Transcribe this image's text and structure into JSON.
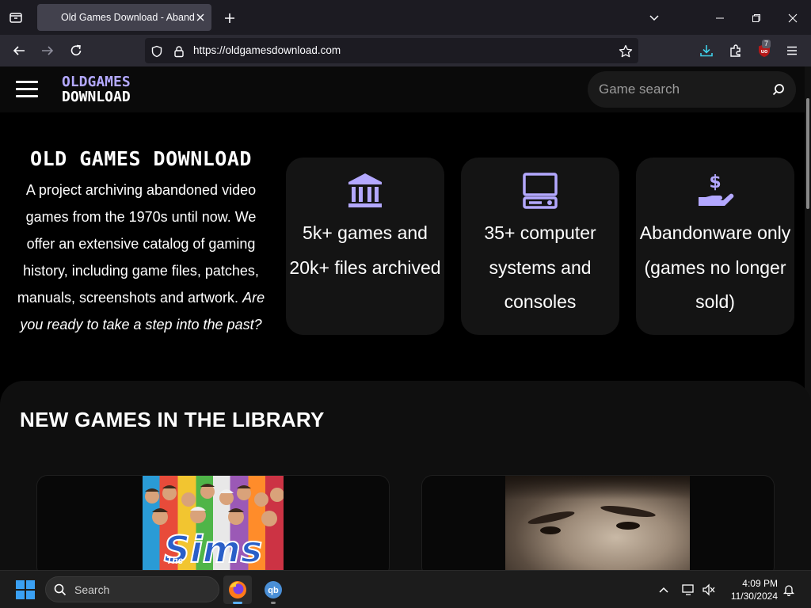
{
  "browser": {
    "tab_title": "Old Games Download - Abandonware Games",
    "url": "https://oldgamesdownload.com",
    "ublock_count": "7"
  },
  "site": {
    "logo_line1": "OLDGAMES",
    "logo_line2": "DOWNLOAD",
    "search_placeholder": "Game search"
  },
  "intro": {
    "title": "OLD GAMES DOWNLOAD",
    "text": "A project archiving abandoned video games from the 1970s until now. We offer an extensive catalog of gaming history, including game files, patches, manuals, screenshots and artwork.",
    "text_italic": "Are you ready to take a step into the past?"
  },
  "features": [
    {
      "icon": "museum-icon",
      "text": "5k+ games and 20k+ files archived"
    },
    {
      "icon": "computer-icon",
      "text": "35+ computer systems and consoles"
    },
    {
      "icon": "dollar-hand-icon",
      "text": "Abandonware only (games no longer sold)"
    }
  ],
  "library": {
    "title": "NEW GAMES IN THE LIBRARY",
    "game1_art_text": "Sims",
    "game1_art_small": "The"
  },
  "taskbar": {
    "search_label": "Search",
    "time": "4:09 PM",
    "date": "11/30/2024"
  },
  "colors": {
    "accent": "#b3a8ff",
    "card_bg": "#141414",
    "page_bg": "#000000"
  }
}
